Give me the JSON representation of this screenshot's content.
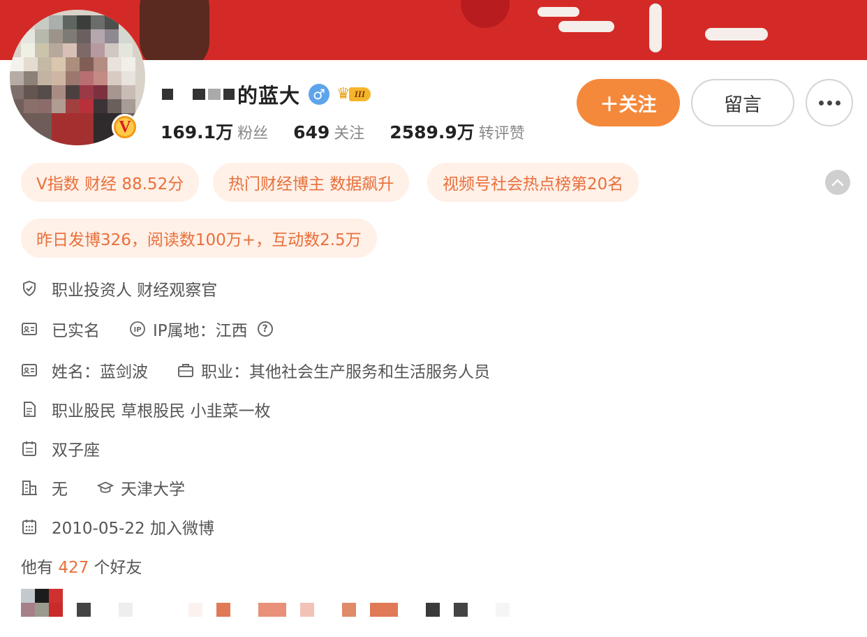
{
  "profile": {
    "name_suffix": "的蓝大",
    "gender_symbol": "♂",
    "crown_symbol": "♛",
    "member_level": "III",
    "verified_badge": "V"
  },
  "stats": [
    {
      "value": "169.1万",
      "label": "粉丝"
    },
    {
      "value": "649",
      "label": "关注"
    },
    {
      "value": "2589.9万",
      "label": "转评赞"
    }
  ],
  "actions": {
    "follow": "＋关注",
    "message": "留言"
  },
  "tags": [
    "V指数 财经 88.52分",
    "热门财经博主 数据飙升",
    "视频号社会热点榜第20名",
    "昨日发博326，阅读数100万+，互动数2.5万"
  ],
  "info": {
    "bio": "职业投资人 财经观察官",
    "real_name_status": "已实名",
    "ip_location": "IP属地：江西",
    "name": "姓名：蓝剑波",
    "occupation": "职业：其他社会生产服务和生活服务人员",
    "description": "职业股民 草根股民 小韭菜一枚",
    "zodiac": "双子座",
    "company": "无",
    "school": "天津大学",
    "join_date": "2010-05-22 加入微博"
  },
  "friends": {
    "prefix": "他有",
    "count": "427",
    "suffix": "个好友"
  },
  "colors": {
    "accent": "#f5893b",
    "tag_bg": "#fff0e8",
    "tag_text": "#e8703a",
    "banner": "#d42a27"
  },
  "icons": [
    "shield-icon",
    "id-card-icon",
    "ip-icon",
    "help-icon",
    "briefcase-icon",
    "document-icon",
    "calendar-icon",
    "building-icon",
    "graduation-cap-icon",
    "calendar-join-icon",
    "more-icon",
    "chevron-up-icon"
  ]
}
